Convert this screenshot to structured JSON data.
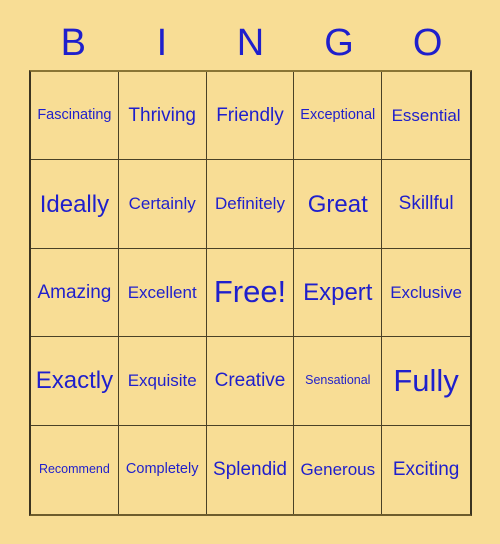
{
  "card": {
    "title_letters": [
      "B",
      "I",
      "N",
      "G",
      "O"
    ],
    "accent_color": "#1f1fcc",
    "background_color": "#f8dd95",
    "border_color": "#4a4126",
    "rows": [
      [
        {
          "label": "Fascinating",
          "size": "sz-s"
        },
        {
          "label": "Thriving",
          "size": "sz-l"
        },
        {
          "label": "Friendly",
          "size": "sz-l"
        },
        {
          "label": "Exceptional",
          "size": "sz-s"
        },
        {
          "label": "Essential",
          "size": "sz-m"
        }
      ],
      [
        {
          "label": "Ideally",
          "size": "sz-xl"
        },
        {
          "label": "Certainly",
          "size": "sz-m"
        },
        {
          "label": "Definitely",
          "size": "sz-m"
        },
        {
          "label": "Great",
          "size": "sz-xl"
        },
        {
          "label": "Skillful",
          "size": "sz-l"
        }
      ],
      [
        {
          "label": "Amazing",
          "size": "sz-l"
        },
        {
          "label": "Excellent",
          "size": "sz-m"
        },
        {
          "label": "Free!",
          "size": "sz-xxl"
        },
        {
          "label": "Expert",
          "size": "sz-xl"
        },
        {
          "label": "Exclusive",
          "size": "sz-m"
        }
      ],
      [
        {
          "label": "Exactly",
          "size": "sz-xl"
        },
        {
          "label": "Exquisite",
          "size": "sz-m"
        },
        {
          "label": "Creative",
          "size": "sz-l"
        },
        {
          "label": "Sensational",
          "size": "sz-xs"
        },
        {
          "label": "Fully",
          "size": "sz-xxl"
        }
      ],
      [
        {
          "label": "Recommend",
          "size": "sz-xs"
        },
        {
          "label": "Completely",
          "size": "sz-s"
        },
        {
          "label": "Splendid",
          "size": "sz-l"
        },
        {
          "label": "Generous",
          "size": "sz-m"
        },
        {
          "label": "Exciting",
          "size": "sz-l"
        }
      ]
    ]
  }
}
